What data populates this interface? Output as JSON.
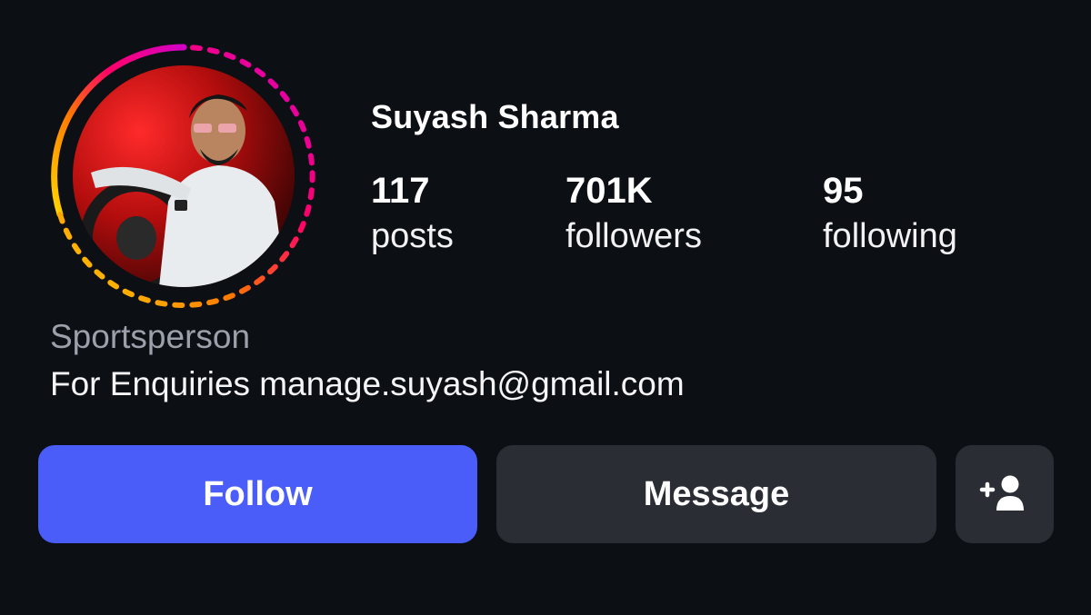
{
  "profile": {
    "name": "Suyash Sharma",
    "category": "Sportsperson",
    "bio": "For Enquiries manage.suyash@gmail.com"
  },
  "stats": {
    "posts": {
      "count": "117",
      "label": "posts"
    },
    "followers": {
      "count": "701K",
      "label": "followers"
    },
    "following": {
      "count": "95",
      "label": "following"
    }
  },
  "actions": {
    "follow_label": "Follow",
    "message_label": "Message",
    "add_user_icon": "add-user-icon"
  },
  "colors": {
    "background": "#0c0f14",
    "follow_button": "#4a5df8",
    "secondary_button": "#2a2d34",
    "category_text": "#9ba0aa",
    "ring_gradient": [
      "#ffd600",
      "#ff7a00",
      "#ff0069",
      "#d300c5"
    ]
  }
}
